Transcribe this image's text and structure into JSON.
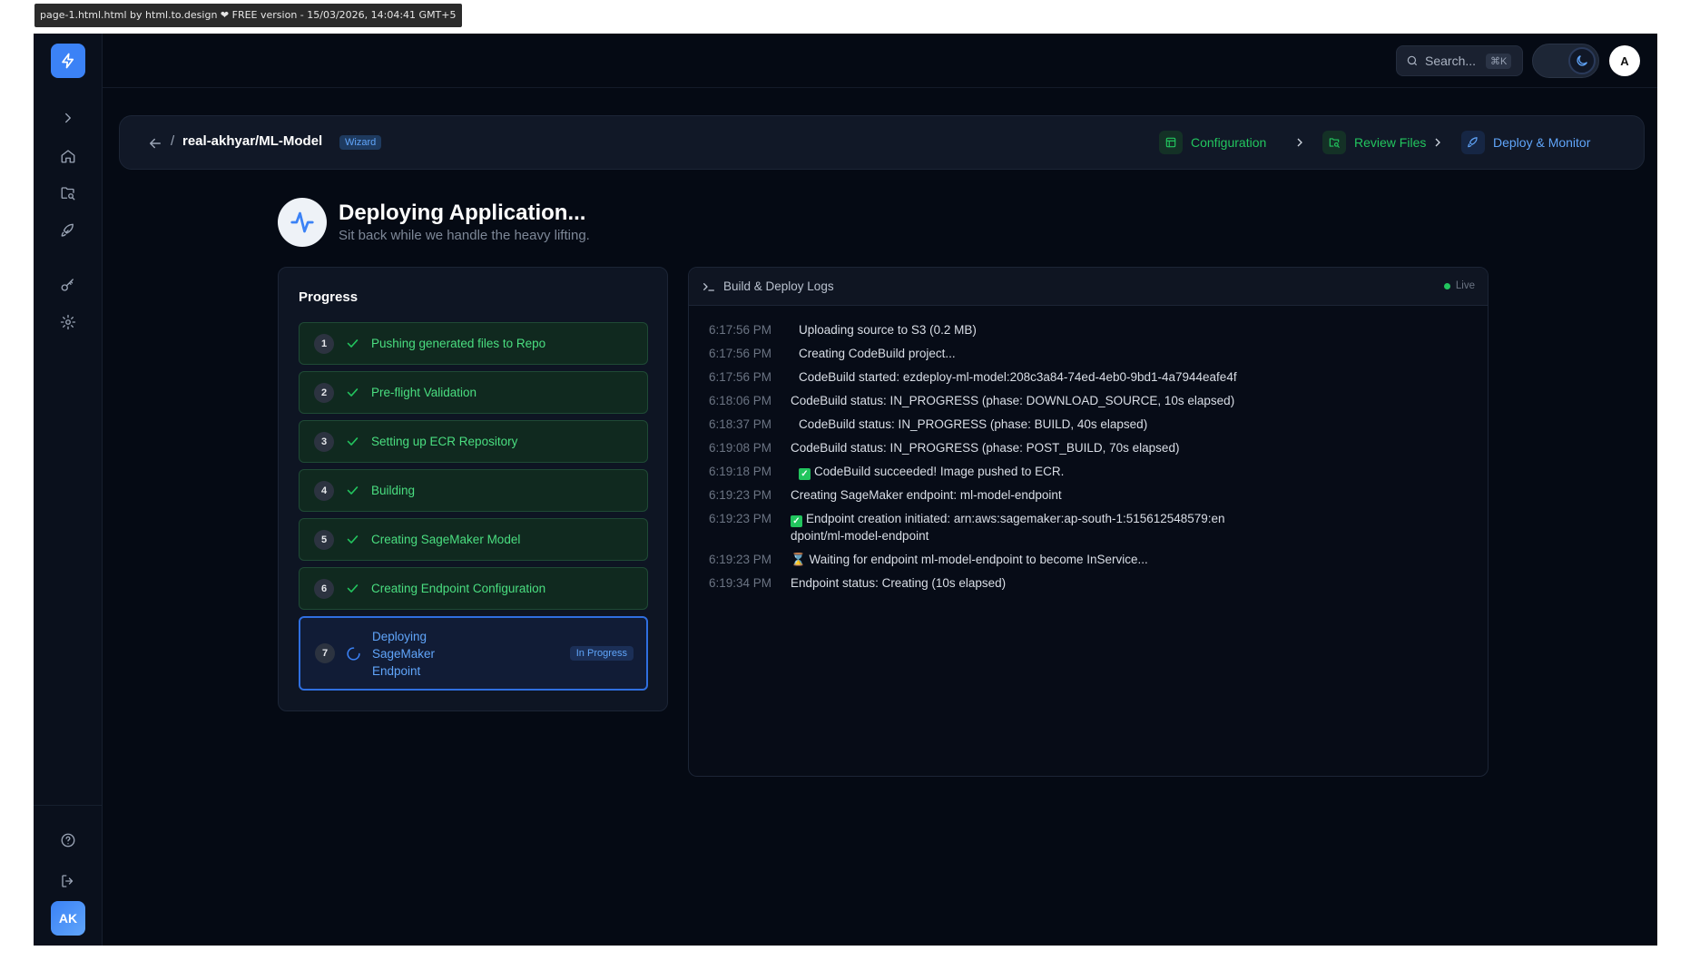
{
  "watermark": "page-1.html.html by html.to.design ❤ FREE version - 15/03/2026, 14:04:41 GMT+5",
  "topbar": {
    "search_placeholder": "Search...",
    "search_shortcut": "⌘K",
    "avatar_initial": "A"
  },
  "sidebar": {
    "user_initials": "AK",
    "items": [
      {
        "icon": "chevron-right-icon"
      },
      {
        "icon": "home-icon"
      },
      {
        "icon": "folder-search-icon"
      },
      {
        "icon": "rocket-icon"
      },
      {
        "icon": "key-icon"
      },
      {
        "icon": "gear-icon"
      },
      {
        "icon": "help-circle-icon"
      },
      {
        "icon": "logout-icon"
      }
    ]
  },
  "header": {
    "separator": "/",
    "repo": "real-akhyar/ML-Model",
    "badge": "Wizard",
    "steps": [
      {
        "label": "Configuration",
        "color": "#22c55e"
      },
      {
        "label": "Review Files",
        "color": "#22c55e"
      },
      {
        "label": "Deploy & Monitor",
        "color": "#60a5fa"
      }
    ]
  },
  "page": {
    "title": "Deploying Application...",
    "subtitle": "Sit back while we handle the heavy lifting."
  },
  "progress": {
    "title": "Progress",
    "steps": [
      {
        "num": "1",
        "label": "Pushing generated files to Repo",
        "status": "done"
      },
      {
        "num": "2",
        "label": "Pre-flight Validation",
        "status": "done"
      },
      {
        "num": "3",
        "label": "Setting up ECR Repository",
        "status": "done"
      },
      {
        "num": "4",
        "label": "Building",
        "status": "done"
      },
      {
        "num": "5",
        "label": "Creating SageMaker Model",
        "status": "done"
      },
      {
        "num": "6",
        "label": "Creating Endpoint Configuration",
        "status": "done"
      },
      {
        "num": "7",
        "label": "Deploying SageMaker Endpoint",
        "status": "active",
        "badge": "In Progress"
      }
    ]
  },
  "logs": {
    "title": "Build & Deploy Logs",
    "live_label": "Live",
    "entries": [
      {
        "time": "6:17:56 PM",
        "message": "Uploading source to S3 (0.2 MB)"
      },
      {
        "time": "6:17:56 PM",
        "message": "Creating CodeBuild project..."
      },
      {
        "time": "6:17:56 PM",
        "message": "CodeBuild started: ezdeploy-ml-model:208c3a84-74ed-4eb0-9bd1-4a7944eafe4f"
      },
      {
        "time": "6:18:06 PM",
        "message": "CodeBuild status: IN_PROGRESS (phase: DOWNLOAD_SOURCE, 10s elapsed)"
      },
      {
        "time": "6:18:37 PM",
        "message": "CodeBuild status: IN_PROGRESS (phase: BUILD, 40s elapsed)"
      },
      {
        "time": "6:19:08 PM",
        "message": "CodeBuild status: IN_PROGRESS (phase: POST_BUILD, 70s elapsed)"
      },
      {
        "time": "6:19:18 PM",
        "message": "CodeBuild succeeded! Image pushed to ECR."
      },
      {
        "time": "6:19:23 PM",
        "message": "Creating SageMaker endpoint: ml-model-endpoint"
      },
      {
        "time": "6:19:23 PM",
        "message": "Endpoint creation initiated: arn:aws:sagemaker:ap-south-1:515612548579:endpoint/ml-model-endpoint"
      },
      {
        "time": "6:19:23 PM",
        "message": "⌛ Waiting for endpoint ml-model-endpoint to become InService..."
      },
      {
        "time": "6:19:34 PM",
        "message": "Endpoint status: Creating (10s elapsed)"
      }
    ]
  }
}
